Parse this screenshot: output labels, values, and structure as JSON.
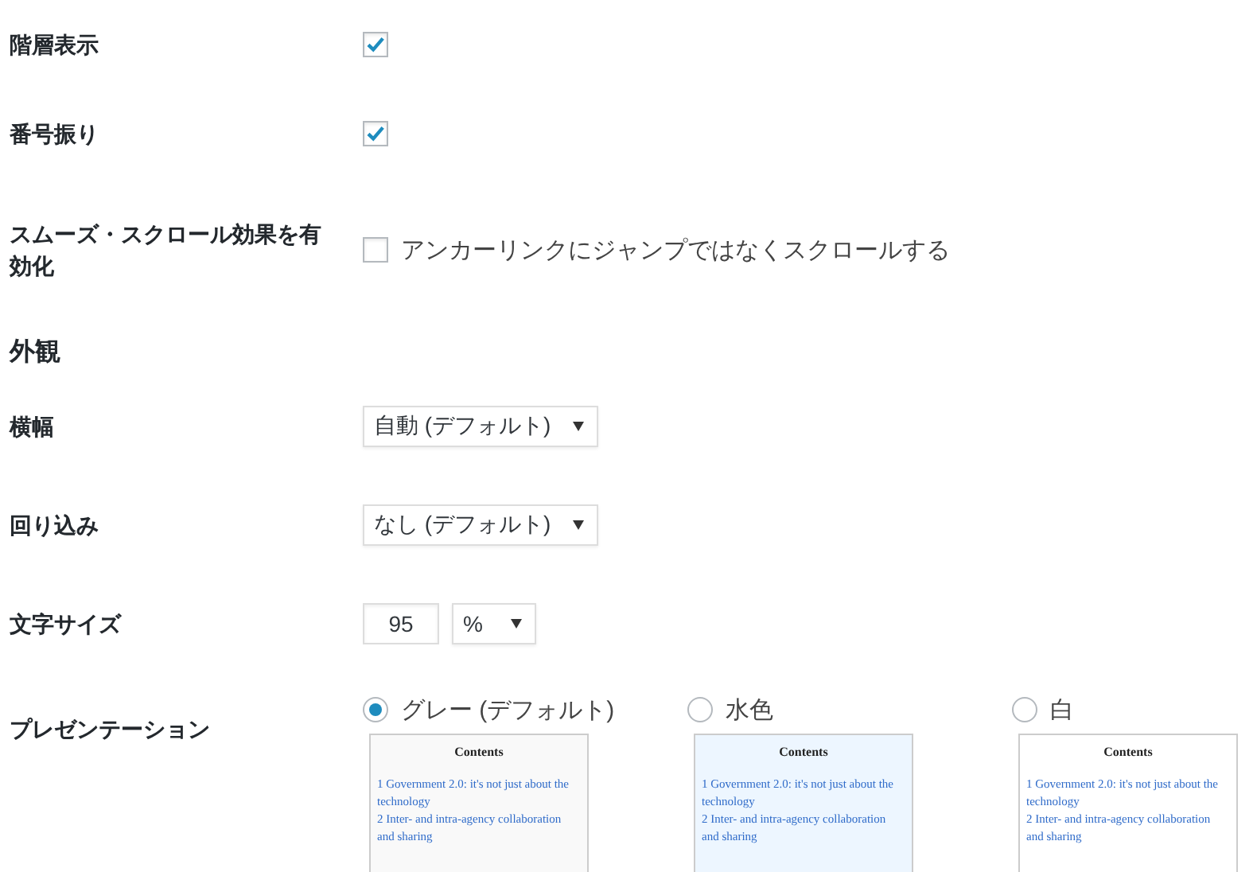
{
  "settings": [
    {
      "kind": "checkbox",
      "label": "階層表示",
      "checked": true
    },
    {
      "kind": "checkbox",
      "label": "番号振り",
      "checked": true
    },
    {
      "kind": "checkbox",
      "label": "スムーズ・スクロール効果を有効化",
      "checked": false,
      "text": "アンカーリンクにジャンプではなくスクロールする"
    }
  ],
  "appearance": {
    "heading": "外観",
    "settings": [
      {
        "kind": "select",
        "label": "横幅",
        "value": "自動 (デフォルト)"
      },
      {
        "kind": "select",
        "label": "回り込み",
        "value": "なし (デフォルト)"
      },
      {
        "kind": "size",
        "label": "文字サイズ",
        "value": "95",
        "unit": "%"
      },
      {
        "kind": "radio",
        "label": "プレゼンテーション",
        "options": [
          {
            "label": "グレー (デフォルト)",
            "selected": true,
            "color": "#f9f9f9",
            "preview": {
              "title": "Contents",
              "items": [
                "1 Government 2.0: it's not just about the technology",
                "2 Inter- and intra-agency collaboration and sharing"
              ]
            }
          },
          {
            "label": "水色",
            "selected": false,
            "color": "#edf6ff",
            "preview": {
              "title": "Contents",
              "items": [
                "1 Government 2.0: it's not just about the technology",
                "2 Inter- and intra-agency collaboration and sharing"
              ]
            }
          },
          {
            "label": "白",
            "selected": false,
            "color": "#ffffff",
            "preview": {
              "title": "Contents",
              "items": [
                "1 Government 2.0: it's not just about the technology",
                "2 Inter- and intra-agency collaboration and sharing"
              ]
            }
          }
        ]
      }
    ]
  }
}
